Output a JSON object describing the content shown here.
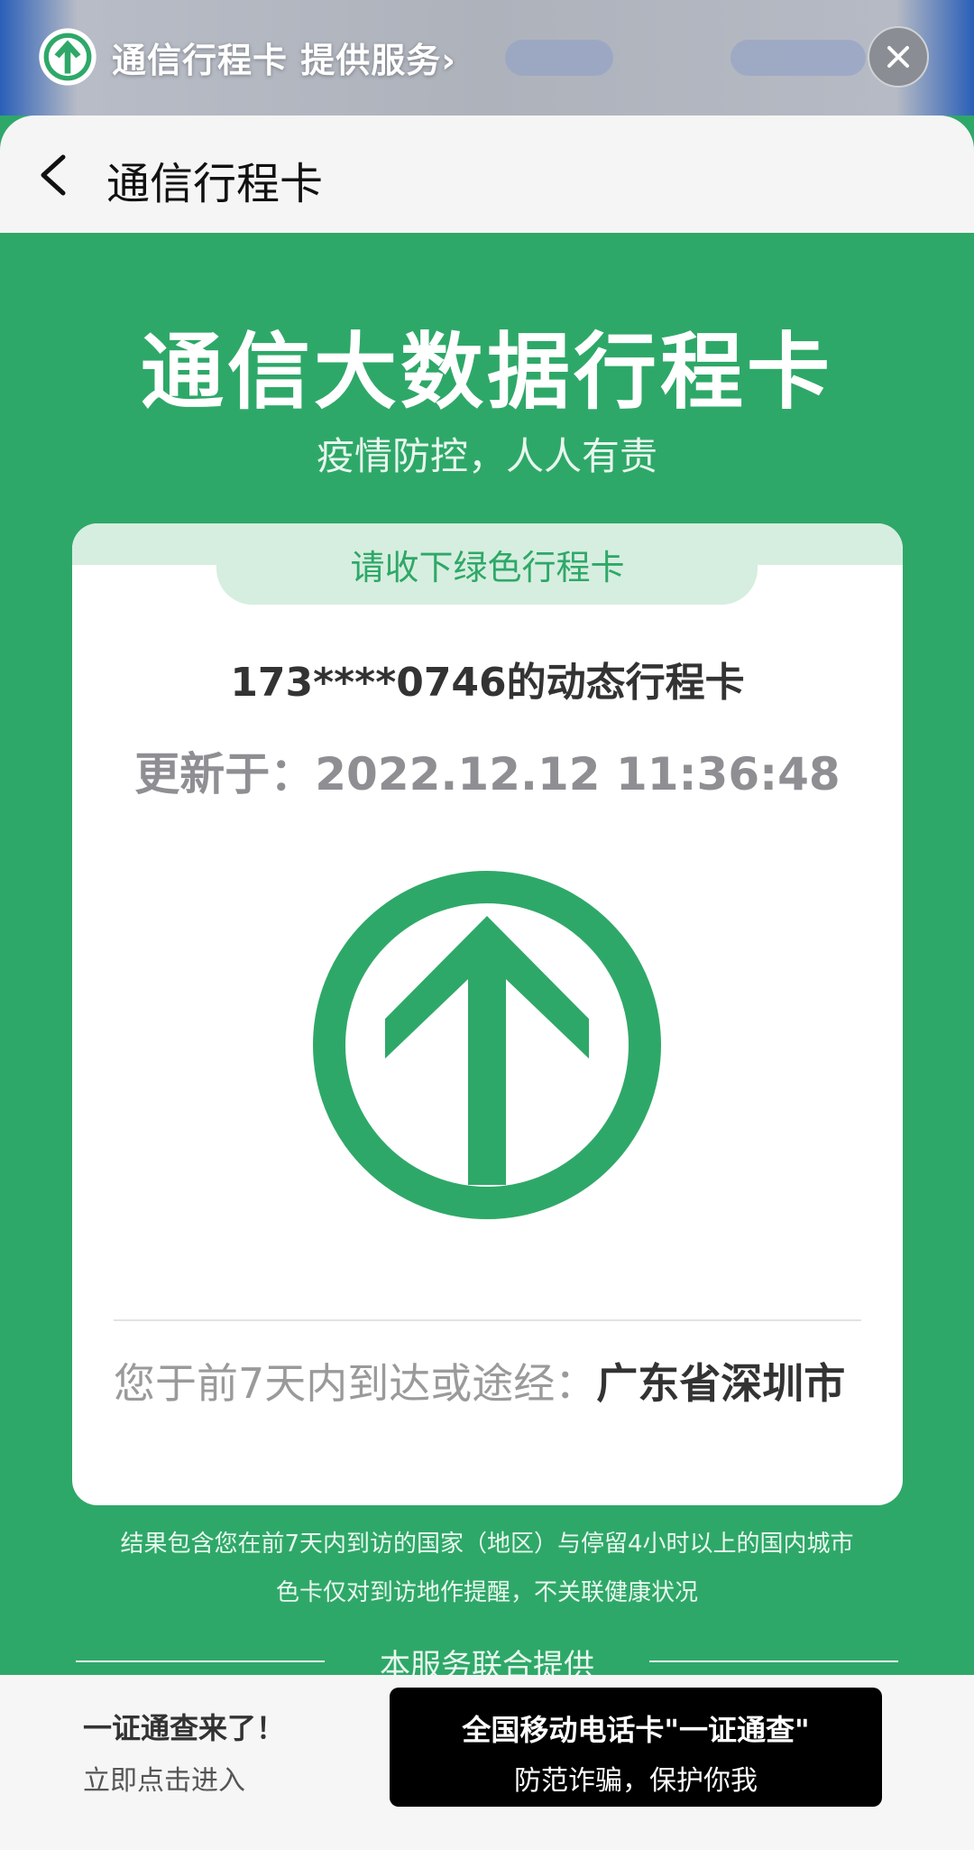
{
  "mini_bar": {
    "title": "通信行程卡 提供服务",
    "chevron": "›"
  },
  "header": {
    "title": "通信行程卡"
  },
  "hero": {
    "title": "通信大数据行程卡",
    "subtitle": "疫情防控，人人有责"
  },
  "card": {
    "tab_label": "请收下绿色行程卡",
    "phone_line": "173****0746的动态行程卡",
    "updated_line": "更新于：2022.12.12 11:36:48",
    "visited_prefix": "您于前7天内到达或途经：",
    "visited_place": "广东省深圳市"
  },
  "notes": {
    "line1": "结果包含您在前7天内到访的国家（地区）与停留4小时以上的国内城市",
    "line2": "色卡仅对到访地作提醒，不关联健康状况",
    "provider": "本服务联合提供"
  },
  "promo": {
    "title": "一证通查来了！",
    "subtitle": "立即点击进入",
    "button_line1": "全国移动电话卡\"一证通查\"",
    "button_line2": "防范诈骗，保护你我"
  },
  "colors": {
    "brand_green": "#2ea868",
    "tab_green_light": "#d6eedf"
  },
  "icons": {
    "logo": "green-up-arrow-circle-icon",
    "close": "close-icon",
    "back": "back-chevron-icon"
  }
}
